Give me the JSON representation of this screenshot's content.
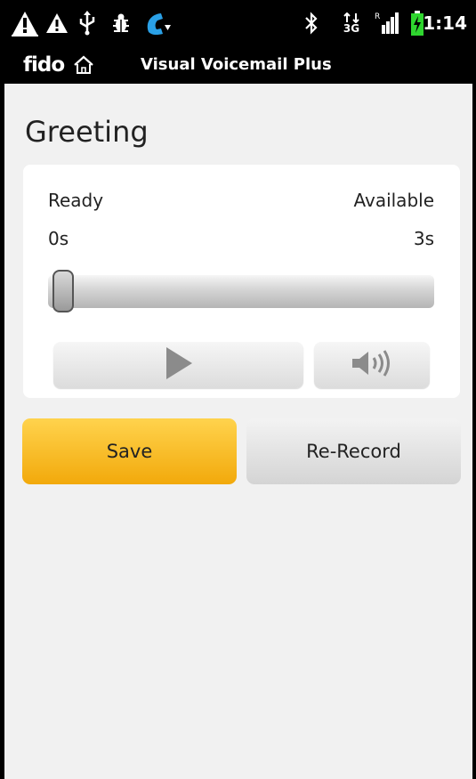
{
  "status_bar": {
    "icons": [
      "warning-icon",
      "warning-icon",
      "usb-icon",
      "debug-icon",
      "call-icon",
      "bluetooth-icon",
      "data-3g-icon",
      "signal-icon",
      "battery-charging-icon"
    ],
    "network_type": "3G",
    "time": "1:14"
  },
  "title_bar": {
    "brand": "fido",
    "title": "Visual Voicemail Plus"
  },
  "page": {
    "title": "Greeting"
  },
  "player": {
    "status_label": "Ready",
    "available_label": "Available",
    "elapsed": "0s",
    "available_time": "3s",
    "progress_fraction": 0.0,
    "play_icon": "play-icon",
    "speaker_icon": "speaker-icon"
  },
  "actions": {
    "save_label": "Save",
    "rerecord_label": "Re-Record"
  },
  "colors": {
    "save_button": "#f5b21e",
    "status_bar": "#000000",
    "charging": "#2fd62f",
    "call_icon": "#2aa0e6"
  }
}
